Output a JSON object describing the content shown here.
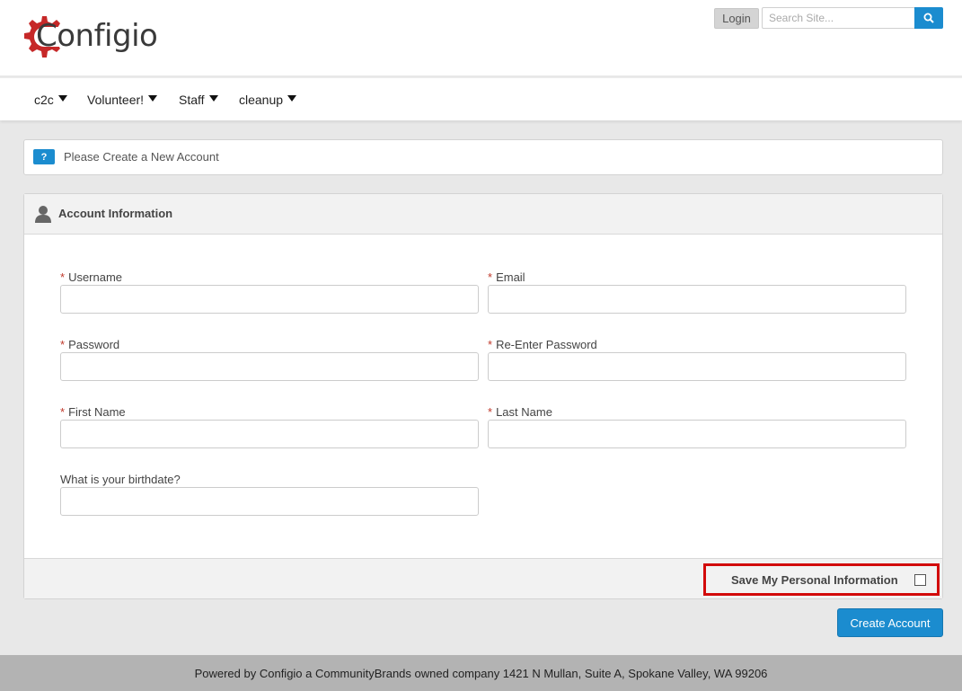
{
  "brand": {
    "name": "Configio",
    "logo_color": "#c62828"
  },
  "header": {
    "login_label": "Login",
    "search_placeholder": "Search Site...",
    "search_icon": "search-icon"
  },
  "nav": {
    "items": [
      {
        "label": "c2c"
      },
      {
        "label": "Volunteer!"
      },
      {
        "label": "Staff"
      },
      {
        "label": "cleanup"
      }
    ]
  },
  "notice": {
    "badge": "?",
    "text": "Please Create a New Account"
  },
  "account_panel": {
    "title": "Account Information",
    "required_marker": "*",
    "fields": {
      "username": {
        "label": "Username",
        "value": ""
      },
      "email": {
        "label": "Email",
        "value": ""
      },
      "password": {
        "label": "Password",
        "value": ""
      },
      "reenter_password": {
        "label": "Re-Enter Password",
        "value": ""
      },
      "first_name": {
        "label": "First Name",
        "value": ""
      },
      "last_name": {
        "label": "Last Name",
        "value": ""
      },
      "birthdate": {
        "label": "What is your birthdate?",
        "value": ""
      }
    },
    "save_info_label": "Save My Personal Information"
  },
  "actions": {
    "create_account_label": "Create Account"
  },
  "footer": {
    "text": "Powered by Configio a CommunityBrands owned company 1421 N Mullan, Suite A, Spokane Valley, WA 99206"
  },
  "colors": {
    "accent": "#1b8ccf",
    "highlight": "#d20a0a",
    "required": "#c0392b"
  }
}
